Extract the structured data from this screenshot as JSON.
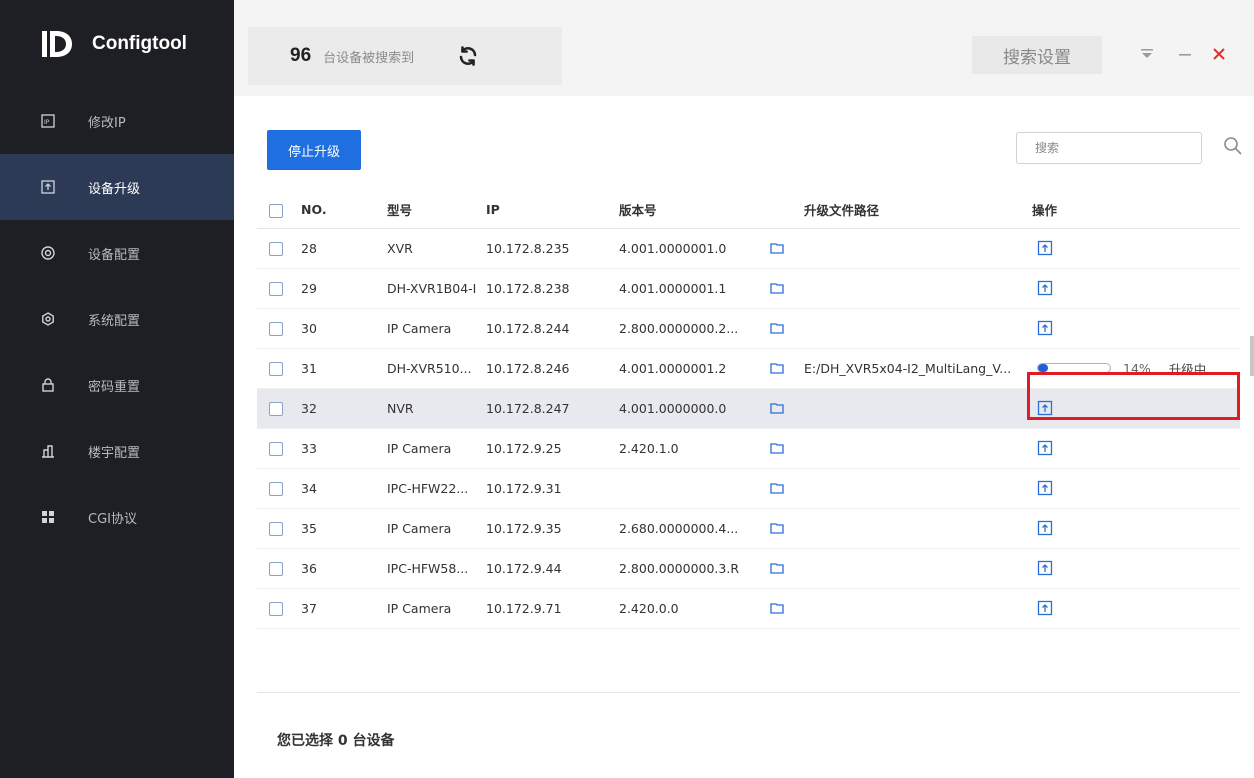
{
  "app": {
    "name": "Configtool"
  },
  "sidebar": {
    "items": [
      {
        "label": "修改IP",
        "icon": "ip-icon",
        "active": false
      },
      {
        "label": "设备升级",
        "icon": "upgrade-icon",
        "active": true
      },
      {
        "label": "设备配置",
        "icon": "device-config-icon",
        "active": false
      },
      {
        "label": "系统配置",
        "icon": "system-config-icon",
        "active": false
      },
      {
        "label": "密码重置",
        "icon": "lock-icon",
        "active": false
      },
      {
        "label": "楼宇配置",
        "icon": "building-icon",
        "active": false
      },
      {
        "label": "CGI协议",
        "icon": "cgi-icon",
        "active": false
      }
    ]
  },
  "header": {
    "device_count": "96",
    "device_count_text": "台设备被搜索到",
    "search_settings_label": "搜索设置"
  },
  "toolbar": {
    "stop_upgrade_label": "停止升级",
    "search_placeholder": "搜索"
  },
  "table": {
    "columns": [
      "NO.",
      "型号",
      "IP",
      "版本号",
      "升级文件路径",
      "操作"
    ],
    "rows": [
      {
        "no": "28",
        "model": "XVR",
        "ip": "10.172.8.235",
        "version": "4.001.0000001.0",
        "path": ""
      },
      {
        "no": "29",
        "model": "DH-XVR1B04-I",
        "ip": "10.172.8.238",
        "version": "4.001.0000001.1",
        "path": ""
      },
      {
        "no": "30",
        "model": "IP Camera",
        "ip": "10.172.8.244",
        "version": "2.800.0000000.2...",
        "path": ""
      },
      {
        "no": "31",
        "model": "DH-XVR510...",
        "ip": "10.172.8.246",
        "version": "4.001.0000001.2",
        "path": "E:/DH_XVR5x04-I2_MultiLang_V...",
        "progress": 14,
        "progress_text": "14%",
        "status": "升级中"
      },
      {
        "no": "32",
        "model": "NVR",
        "ip": "10.172.8.247",
        "version": "4.001.0000000.0",
        "path": ""
      },
      {
        "no": "33",
        "model": "IP Camera",
        "ip": "10.172.9.25",
        "version": "2.420.1.0",
        "path": ""
      },
      {
        "no": "34",
        "model": "IPC-HFW22...",
        "ip": "10.172.9.31",
        "version": "",
        "path": ""
      },
      {
        "no": "35",
        "model": "IP Camera",
        "ip": "10.172.9.35",
        "version": "2.680.0000000.4...",
        "path": ""
      },
      {
        "no": "36",
        "model": "IPC-HFW58...",
        "ip": "10.172.9.44",
        "version": "2.800.0000000.3.R",
        "path": ""
      },
      {
        "no": "37",
        "model": "IP Camera",
        "ip": "10.172.9.71",
        "version": "2.420.0.0",
        "path": ""
      }
    ]
  },
  "footer": {
    "selection_text": "您已选择 0 台设备"
  },
  "colors": {
    "accent": "#1f6fe0",
    "sidebar_bg": "#1e1f24",
    "sidebar_active": "#2d3a55",
    "highlight": "#e01b24"
  }
}
